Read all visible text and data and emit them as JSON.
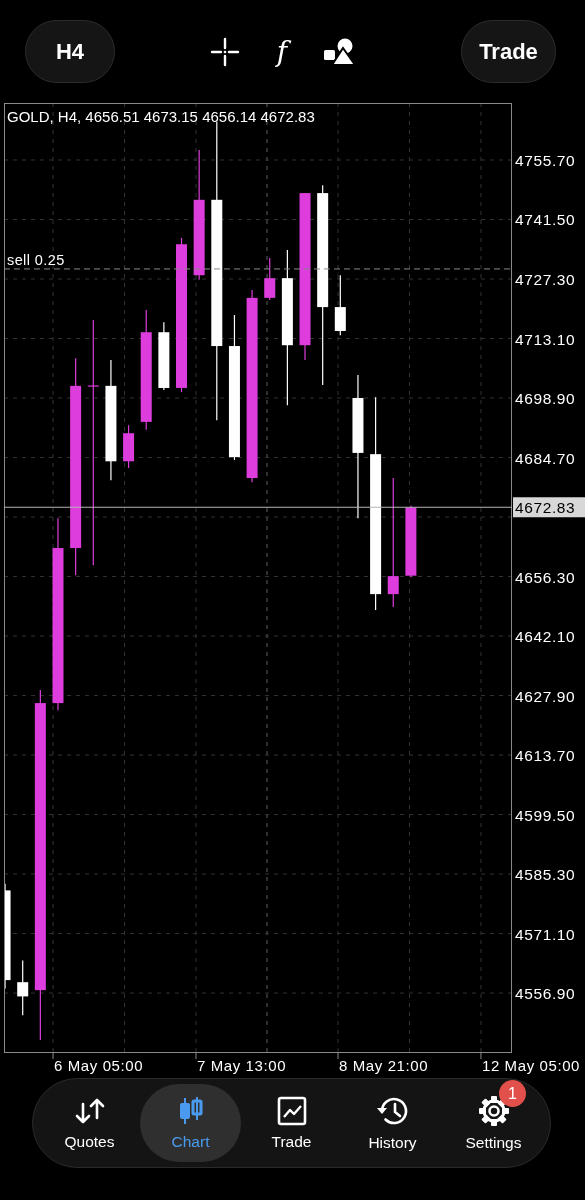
{
  "toolbar": {
    "timeframe": "H4",
    "tools": [
      {
        "kind": "crosshair"
      },
      {
        "kind": "function",
        "label": "f"
      },
      {
        "kind": "shapes"
      }
    ],
    "trade_button": "Trade"
  },
  "chart": {
    "header": "GOLD, H4, 4656.51 4673.15 4656.14 4672.83",
    "price_labels": [
      "4755.70",
      "4741.50",
      "4727.30",
      "4713.10",
      "4698.90",
      "4684.70",
      "4656.30",
      "4642.10",
      "4627.90",
      "4613.70",
      "4599.50",
      "4585.30",
      "4571.10",
      "4556.90"
    ],
    "time_labels": [
      "6 May 05:00",
      "7 May 13:00",
      "8 May 21:00",
      "12 May 05:00"
    ],
    "order_line": {
      "label": "sell 0.25"
    },
    "price_tag": "4672.83"
  },
  "tab_bar": {
    "tabs": [
      {
        "kind": "quotes",
        "label": "Quotes",
        "selected": false
      },
      {
        "kind": "chart",
        "label": "Chart",
        "selected": true
      },
      {
        "kind": "trade",
        "label": "Trade",
        "selected": false
      },
      {
        "kind": "history",
        "label": "History",
        "selected": false
      },
      {
        "kind": "settings",
        "label": "Settings",
        "selected": false,
        "badge": "1"
      }
    ]
  }
}
